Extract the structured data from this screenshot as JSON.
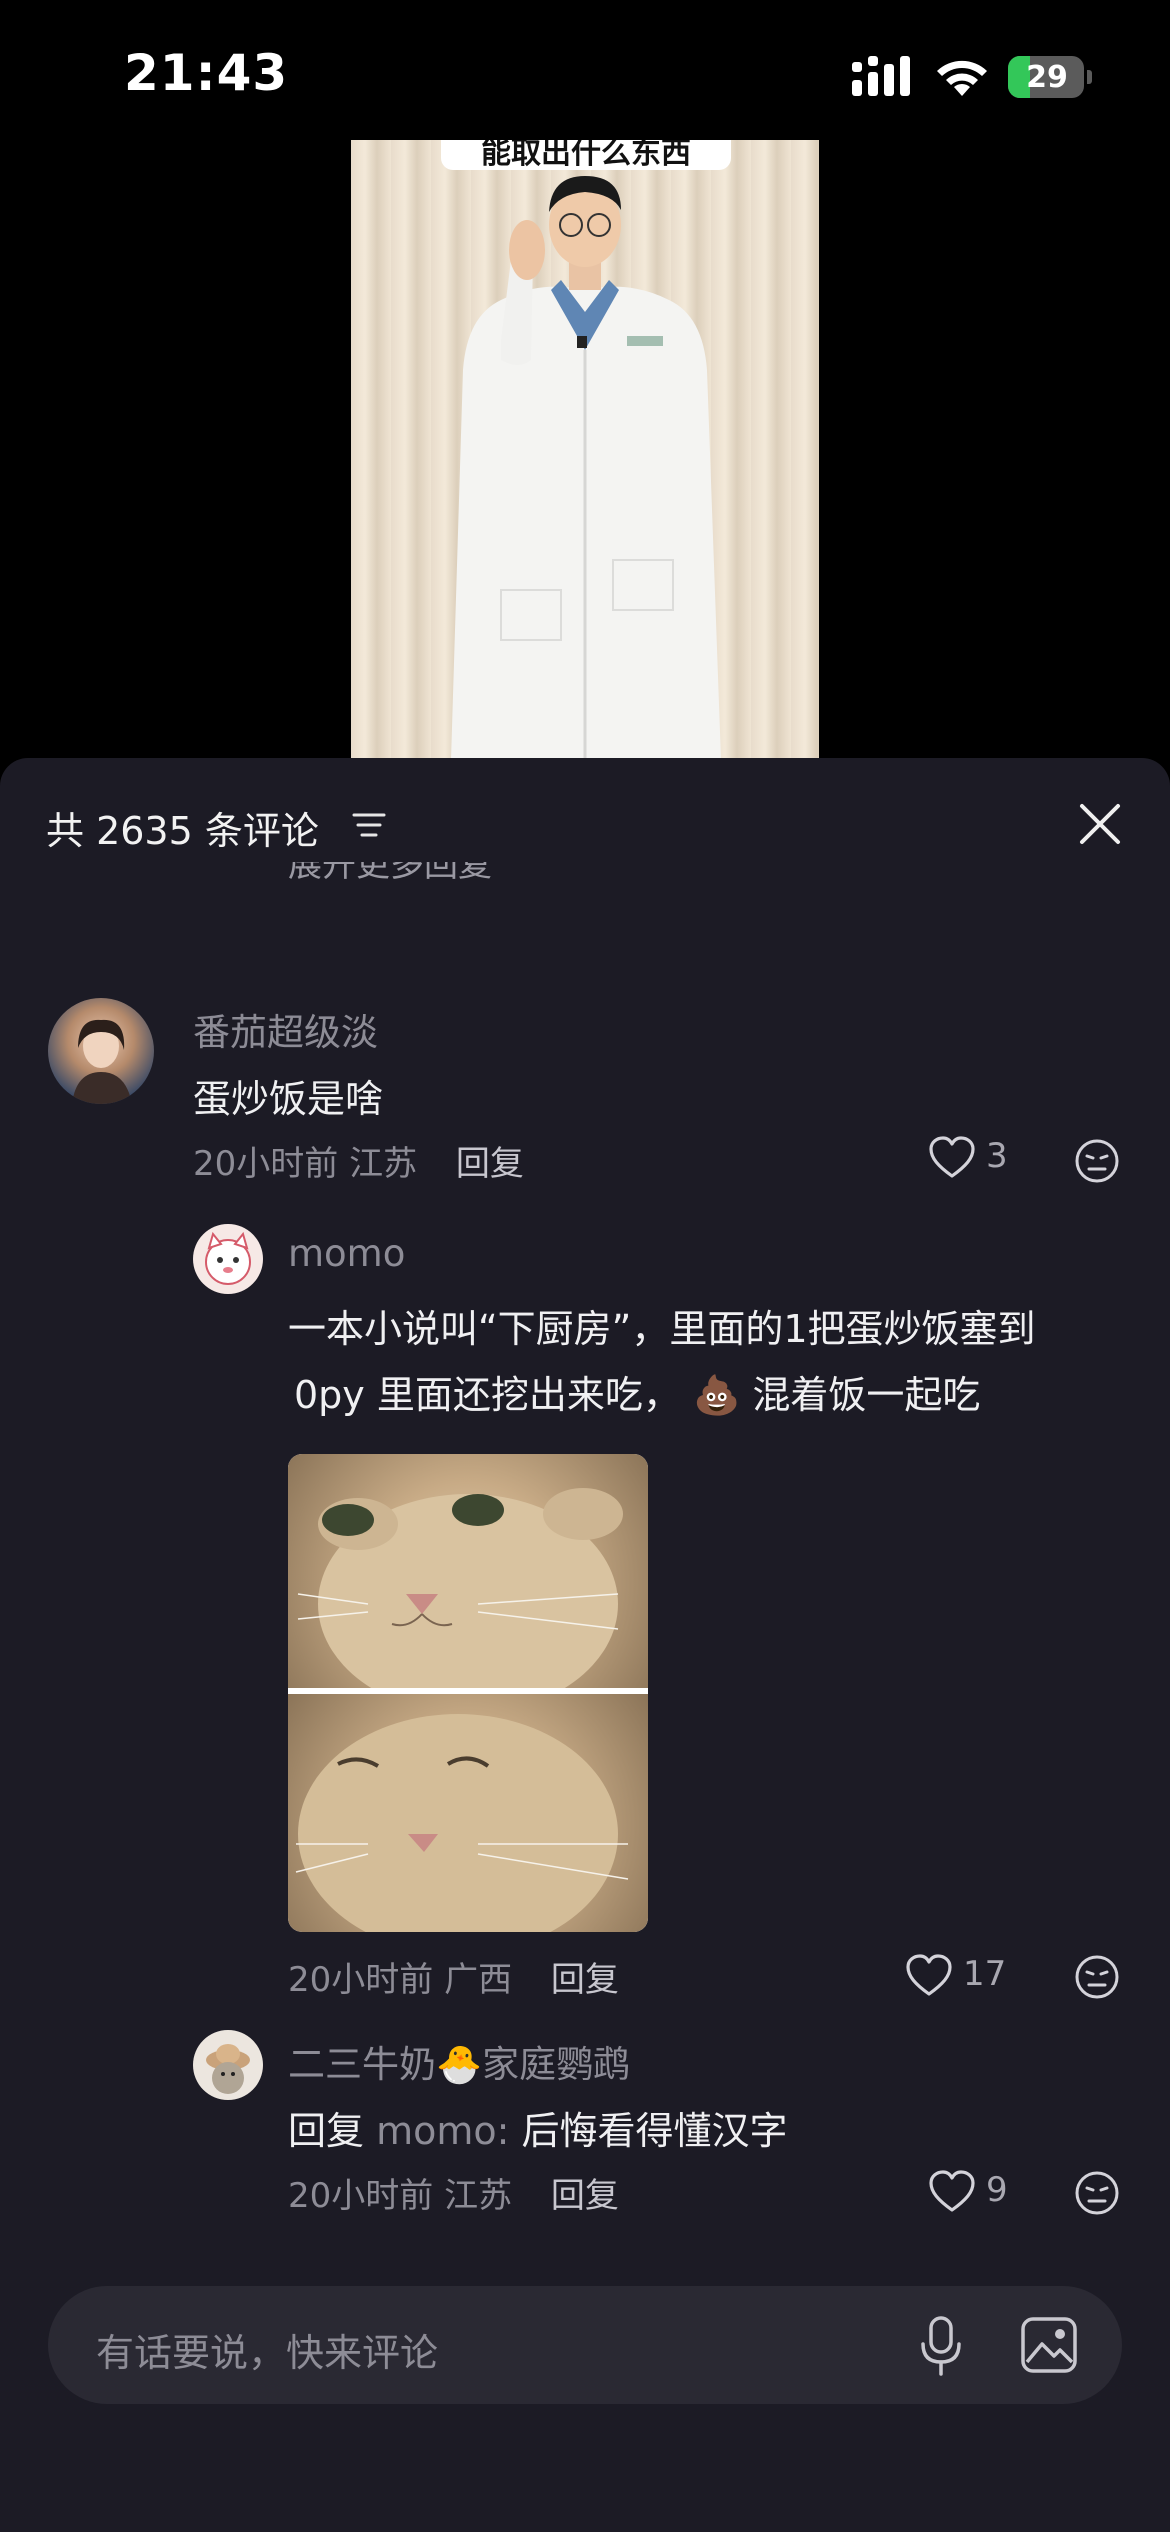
{
  "status_bar": {
    "time": "21:43",
    "battery": "29",
    "battery_level": 0.29
  },
  "video": {
    "caption": "能取出什么东西"
  },
  "sheet": {
    "comment_count_label": "共 2635 条评论",
    "expand_more": "展开更多回复"
  },
  "comments": [
    {
      "username": "番茄超级淡",
      "text": "蛋炒饭是啥",
      "time": "20小时前",
      "location": "江苏",
      "reply_label": "回复",
      "likes": "3"
    },
    {
      "username": "momo",
      "text_line1": "一本小说叫“下厨房”，里面的1把蛋炒饭塞到",
      "text_line2": "0py 里面还挖出来吃，",
      "emoji": "💩",
      "text_line2_tail": "混着饭一起吃",
      "time": "20小时前",
      "location": "广西",
      "reply_label": "回复",
      "likes": "17"
    },
    {
      "username": "二三牛奶",
      "username_emoji": "🐣",
      "username_suffix": "家庭鹦鹉",
      "reply_prefix": "回复",
      "reply_to": "momo:",
      "text": "后悔看得懂汉字",
      "time": "20小时前",
      "location": "江苏",
      "reply_label": "回复",
      "likes": "9"
    }
  ],
  "input": {
    "placeholder": "有话要说，快来评论"
  },
  "colors": {
    "sheet_bg": "#1c1b25",
    "input_bg": "#2a2933",
    "battery_green": "#33c759"
  }
}
